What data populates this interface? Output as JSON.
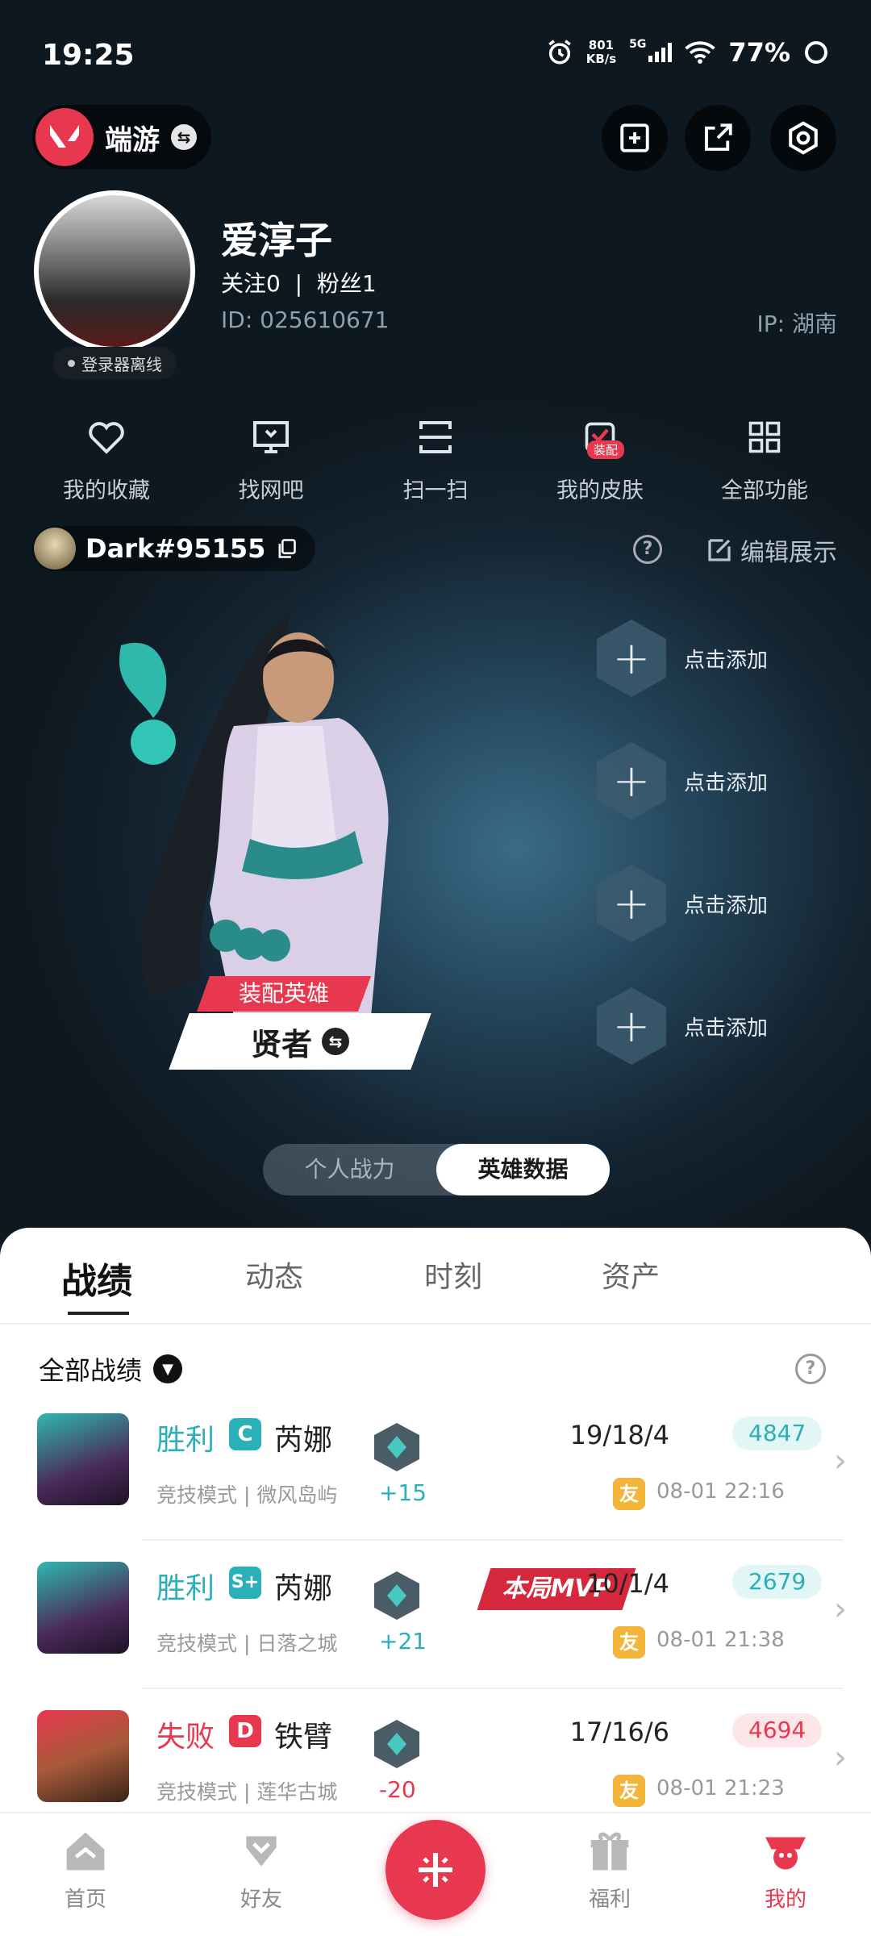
{
  "status": {
    "time": "19:25",
    "net_speed": "801",
    "net_unit": "KB/s",
    "signal_type": "5G",
    "battery": "77%"
  },
  "header": {
    "brand": "端游"
  },
  "profile": {
    "name": "爱淳子",
    "follow": "关注0  |  粉丝1",
    "id": "ID: 025610671",
    "ip": "IP: 湖南",
    "offline": "登录器离线"
  },
  "quick": [
    {
      "icon": "heart-icon",
      "label": "我的收藏"
    },
    {
      "icon": "monitor-icon",
      "label": "找网吧"
    },
    {
      "icon": "scan-icon",
      "label": "扫一扫"
    },
    {
      "icon": "skin-icon",
      "label": "我的皮肤",
      "badge": "装配"
    },
    {
      "icon": "grid-icon",
      "label": "全部功能"
    }
  ],
  "game": {
    "account": "Dark#95155",
    "edit": "编辑展示"
  },
  "hero": {
    "tag": "装配英雄",
    "name": "贤者"
  },
  "slots": [
    "点击添加",
    "点击添加",
    "点击添加",
    "点击添加"
  ],
  "segment": {
    "left": "个人战力",
    "right": "英雄数据"
  },
  "tabs": [
    "战绩",
    "动态",
    "时刻",
    "资产"
  ],
  "filter": "全部战绩",
  "matches": [
    {
      "result": "胜利",
      "grade": "C",
      "hero": "芮娜",
      "mode": "竞技模式 | 微风岛屿",
      "delta": "+15",
      "kda": "19/18/4",
      "score": "4847",
      "friend": "友",
      "time": "08-01 22:16"
    },
    {
      "result": "胜利",
      "grade": "S+",
      "hero": "芮娜",
      "mode": "竞技模式 | 日落之城",
      "delta": "+21",
      "kda": "10/1/4",
      "score": "2679",
      "friend": "友",
      "time": "08-01 21:38",
      "mvp": "本局MVP"
    },
    {
      "result": "失败",
      "grade": "D",
      "hero": "铁臂",
      "mode": "竞技模式 | 莲华古城",
      "delta": "-20",
      "kda": "17/16/6",
      "score": "4694",
      "friend": "友",
      "time": "08-01 21:23"
    }
  ],
  "nav": [
    "首页",
    "好友",
    "福利",
    "我的"
  ],
  "colors": {
    "accent": "#e8384f",
    "win": "#2ab0b8",
    "loss": "#e8384f",
    "friend": "#f2b53a"
  }
}
